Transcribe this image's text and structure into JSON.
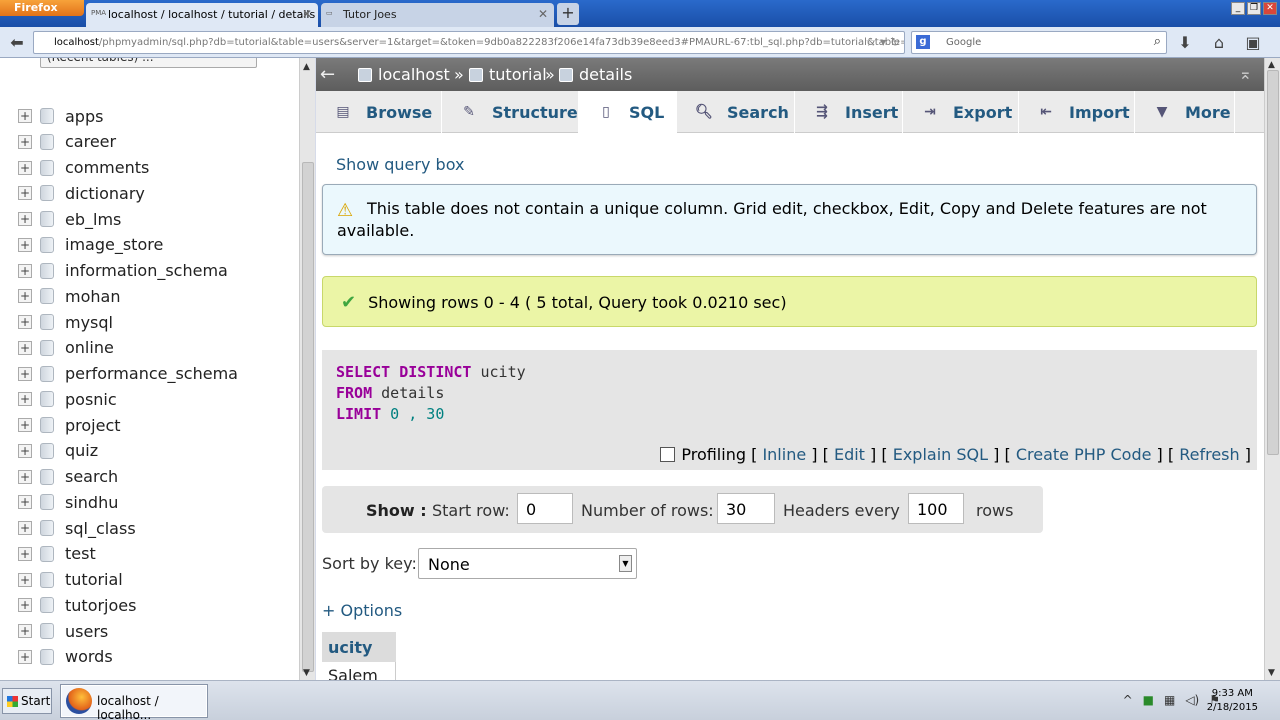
{
  "browser": {
    "app_button": "Firefox",
    "tabs": [
      {
        "label": "localhost / localhost / tutorial / details | p...",
        "icon": "PMA"
      },
      {
        "label": "Tutor Joes"
      }
    ],
    "url": {
      "host": "localhost",
      "path": "/phpmyadmin/sql.php?db=tutorial&table=users&server=1&target=&token=9db0a822283f206e14fa73db39e8eed3#PMAURL-67:tbl_sql.php?db=tutorial&table=details"
    },
    "search_placeholder": "Google"
  },
  "sidebar": {
    "recent_label": "(Recent tables) ...",
    "databases": [
      "apps",
      "career",
      "comments",
      "dictionary",
      "eb_lms",
      "image_store",
      "information_schema",
      "mohan",
      "mysql",
      "online",
      "performance_schema",
      "posnic",
      "project",
      "quiz",
      "search",
      "sindhu",
      "sql_class",
      "test",
      "tutorial",
      "tutorjoes",
      "users",
      "words"
    ]
  },
  "breadcrumb": {
    "server": "localhost",
    "sep1": "»",
    "database": "tutorial",
    "sep2": "»",
    "table": "details"
  },
  "tabs": [
    {
      "label": "Browse",
      "icon": "browse-icon"
    },
    {
      "label": "Structure",
      "icon": "structure-icon"
    },
    {
      "label": "SQL",
      "icon": "sql-icon",
      "active": true
    },
    {
      "label": "Search",
      "icon": "search-icon"
    },
    {
      "label": "Insert",
      "icon": "insert-icon"
    },
    {
      "label": "Export",
      "icon": "export-icon"
    },
    {
      "label": "Import",
      "icon": "import-icon"
    },
    {
      "label": "More",
      "icon": "more-icon"
    }
  ],
  "show_query_box": "Show query box",
  "notice": "This table does not contain a unique column. Grid edit, checkbox, Edit, Copy and Delete features are not available.",
  "success": "Showing rows 0 - 4 ( 5 total, Query took 0.0210 sec)",
  "sql": {
    "line1_kw": "SELECT DISTINCT",
    "line1_rest": " ucity",
    "line2_kw": "FROM",
    "line2_rest": " details",
    "line3_kw": "LIMIT",
    "line3_rest": " 0 , 30"
  },
  "sql_actions": {
    "profiling": "Profiling",
    "open": "[",
    "close": "]",
    "inline": "Inline",
    "edit": "Edit",
    "explain": "Explain SQL",
    "create_php": "Create PHP Code",
    "refresh": "Refresh"
  },
  "show_bar": {
    "show": "Show :",
    "start_row": "Start row:",
    "start_row_value": "0",
    "num_rows": "Number of rows:",
    "num_rows_value": "30",
    "headers_every": "Headers every",
    "headers_every_value": "100",
    "rows": "rows"
  },
  "sort_by_key": {
    "label": "Sort by key:",
    "value": "None"
  },
  "options_link": "+ Options",
  "results": {
    "column": "ucity",
    "first_cell": "Salem"
  },
  "taskbar": {
    "start": "Start",
    "task": "localhost / localho...",
    "time": "9:33 AM",
    "date": "2/18/2015"
  }
}
